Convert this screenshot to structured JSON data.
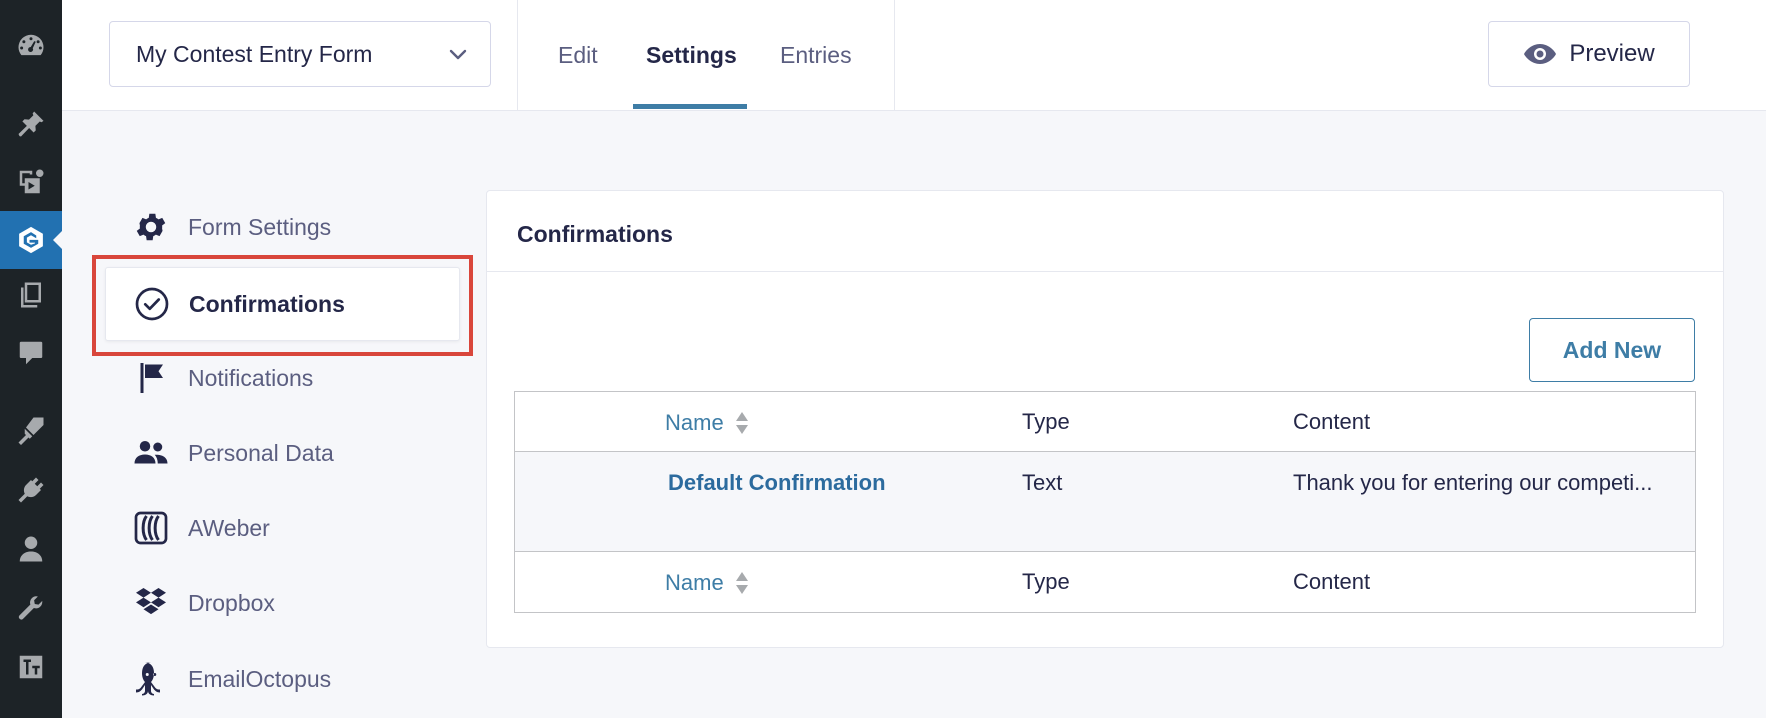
{
  "wp_sidebar": {
    "items": [
      {
        "icon": "dashboard-icon"
      },
      {
        "icon": "pin-icon"
      },
      {
        "icon": "media-icon"
      },
      {
        "icon": "gravityforms-icon",
        "active": true
      },
      {
        "icon": "pages-icon"
      },
      {
        "icon": "comments-icon"
      },
      {
        "icon": "appearance-icon"
      },
      {
        "icon": "plugins-icon"
      },
      {
        "icon": "users-icon"
      },
      {
        "icon": "tools-icon"
      },
      {
        "icon": "settings-icon"
      }
    ]
  },
  "header": {
    "form_selector": "My Contest Entry Form",
    "tabs": [
      {
        "label": "Edit"
      },
      {
        "label": "Settings",
        "active": true
      },
      {
        "label": "Entries"
      }
    ],
    "preview_label": "Preview"
  },
  "settings_nav": {
    "items": [
      {
        "label": "Form Settings",
        "icon": "gear-icon"
      },
      {
        "label": "Confirmations",
        "icon": "check-circle-icon",
        "active": true
      },
      {
        "label": "Notifications",
        "icon": "flag-icon"
      },
      {
        "label": "Personal Data",
        "icon": "people-icon"
      },
      {
        "label": "AWeber",
        "icon": "aweber-icon"
      },
      {
        "label": "Dropbox",
        "icon": "dropbox-icon"
      },
      {
        "label": "EmailOctopus",
        "icon": "octopus-icon"
      }
    ]
  },
  "panel": {
    "title": "Confirmations",
    "add_new_label": "Add New",
    "table": {
      "columns": [
        "Name",
        "Type",
        "Content"
      ],
      "rows": [
        {
          "name": "Default Confirmation",
          "type": "Text",
          "content": "Thank you for entering our competi..."
        }
      ]
    }
  },
  "colors": {
    "accent": "#3e7da6",
    "highlight": "#d9463b",
    "wp_sidebar_bg": "#1d2327",
    "wp_active": "#2271b1"
  }
}
